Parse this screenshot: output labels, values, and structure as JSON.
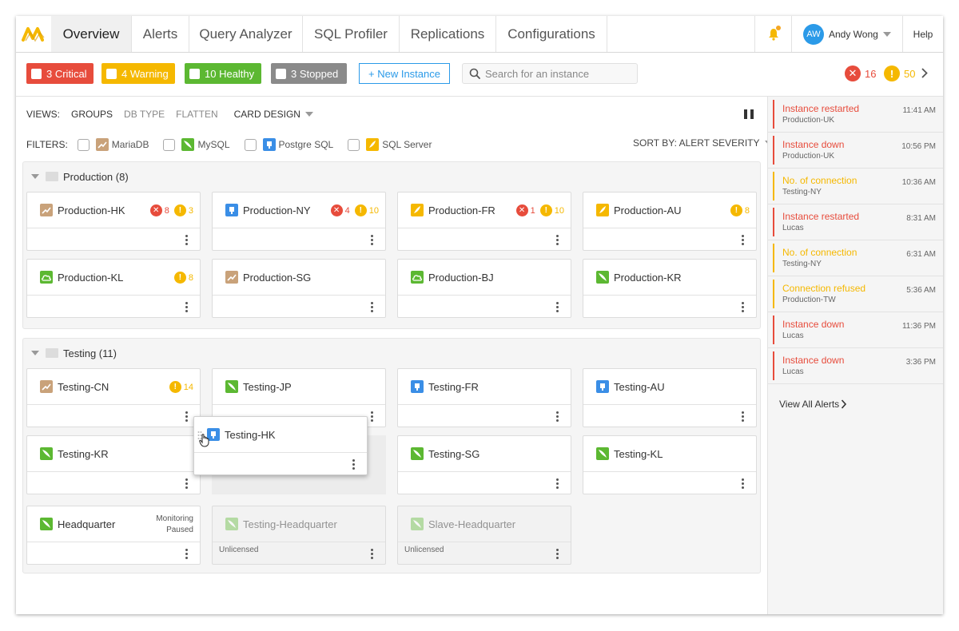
{
  "nav": {
    "tabs": [
      "Overview",
      "Alerts",
      "Query Analyzer",
      "SQL Profiler",
      "Replications",
      "Configurations"
    ],
    "active_tab": "Overview",
    "user_initials": "AW",
    "user_name": "Andy Wong",
    "help": "Help"
  },
  "toolbar": {
    "critical": "3 Critical",
    "warning": "4 Warning",
    "healthy": "10 Healthy",
    "stopped": "3 Stopped",
    "new_instance": "+ New Instance",
    "search_placeholder": "Search for an instance",
    "critical_count": "16",
    "warning_count": "50",
    "colors": {
      "critical": "#e74c3c",
      "warning": "#f5b800",
      "healthy": "#5cb832",
      "stopped": "#8a8a8a",
      "accent": "#2b9ae8"
    }
  },
  "views": {
    "label": "VIEWS:",
    "options": [
      "GROUPS",
      "DB TYPE",
      "FLATTEN"
    ],
    "card_design": "CARD DESIGN"
  },
  "filters": {
    "label": "FILTERS:",
    "items": [
      "MariaDB",
      "MySQL",
      "Postgre SQL",
      "SQL Server"
    ],
    "sort_by": "SORT BY: ALERT SEVERITY"
  },
  "groups": [
    {
      "title": "Production (8)",
      "cards": [
        {
          "name": "Production-HK",
          "db": "mariadb",
          "critical": "8",
          "warning": "3"
        },
        {
          "name": "Production-NY",
          "db": "postgres",
          "critical": "4",
          "warning": "10"
        },
        {
          "name": "Production-FR",
          "db": "sqlserver",
          "critical": "1",
          "warning": "10"
        },
        {
          "name": "Production-AU",
          "db": "sqlserver",
          "warning": "8"
        },
        {
          "name": "Production-KL",
          "db": "cloud",
          "warning": "8"
        },
        {
          "name": "Production-SG",
          "db": "mariadb"
        },
        {
          "name": "Production-BJ",
          "db": "cloud"
        },
        {
          "name": "Production-KR",
          "db": "mysql"
        }
      ]
    },
    {
      "title": "Testing (11)",
      "cards": [
        {
          "name": "Testing-CN",
          "db": "mariadb",
          "warning": "14"
        },
        {
          "name": "Testing-JP",
          "db": "mysql"
        },
        {
          "name": "Testing-FR",
          "db": "postgres"
        },
        {
          "name": "Testing-AU",
          "db": "postgres"
        },
        {
          "name": "Testing-KR",
          "db": "mysql"
        },
        {
          "name": "Testing-SG",
          "db": "mysql"
        },
        {
          "name": "Testing-KL",
          "db": "mysql"
        },
        {
          "name": "Headquarter",
          "db": "mysql",
          "status_line1": "Monitoring",
          "status_line2": "Paused"
        },
        {
          "name": "Testing-Headquarter",
          "db": "mysql",
          "unlicensed": "Unlicensed"
        },
        {
          "name": "Slave-Headquarter",
          "db": "mysql",
          "unlicensed": "Unlicensed"
        }
      ],
      "dragging": {
        "name": "Testing-HK",
        "db": "postgres"
      }
    }
  ],
  "alerts": [
    {
      "title": "Instance restarted",
      "sub": "Production-UK",
      "time": "11:41 AM",
      "level": "critical"
    },
    {
      "title": "Instance down",
      "sub": "Production-UK",
      "time": "10:56 PM",
      "level": "critical"
    },
    {
      "title": "No. of connection",
      "sub": "Testing-NY",
      "time": "10:36 AM",
      "level": "warning"
    },
    {
      "title": "Instance restarted",
      "sub": "Lucas",
      "time": "8:31 AM",
      "level": "critical"
    },
    {
      "title": "No. of connection",
      "sub": "Testing-NY",
      "time": "6:31 AM",
      "level": "warning"
    },
    {
      "title": "Connection refused",
      "sub": "Production-TW",
      "time": "5:36 AM",
      "level": "warning"
    },
    {
      "title": "Instance down",
      "sub": "Lucas",
      "time": "11:36 PM",
      "level": "critical"
    },
    {
      "title": "Instance down",
      "sub": "Lucas",
      "time": "3:36 PM",
      "level": "critical"
    }
  ],
  "view_all": "View All Alerts"
}
